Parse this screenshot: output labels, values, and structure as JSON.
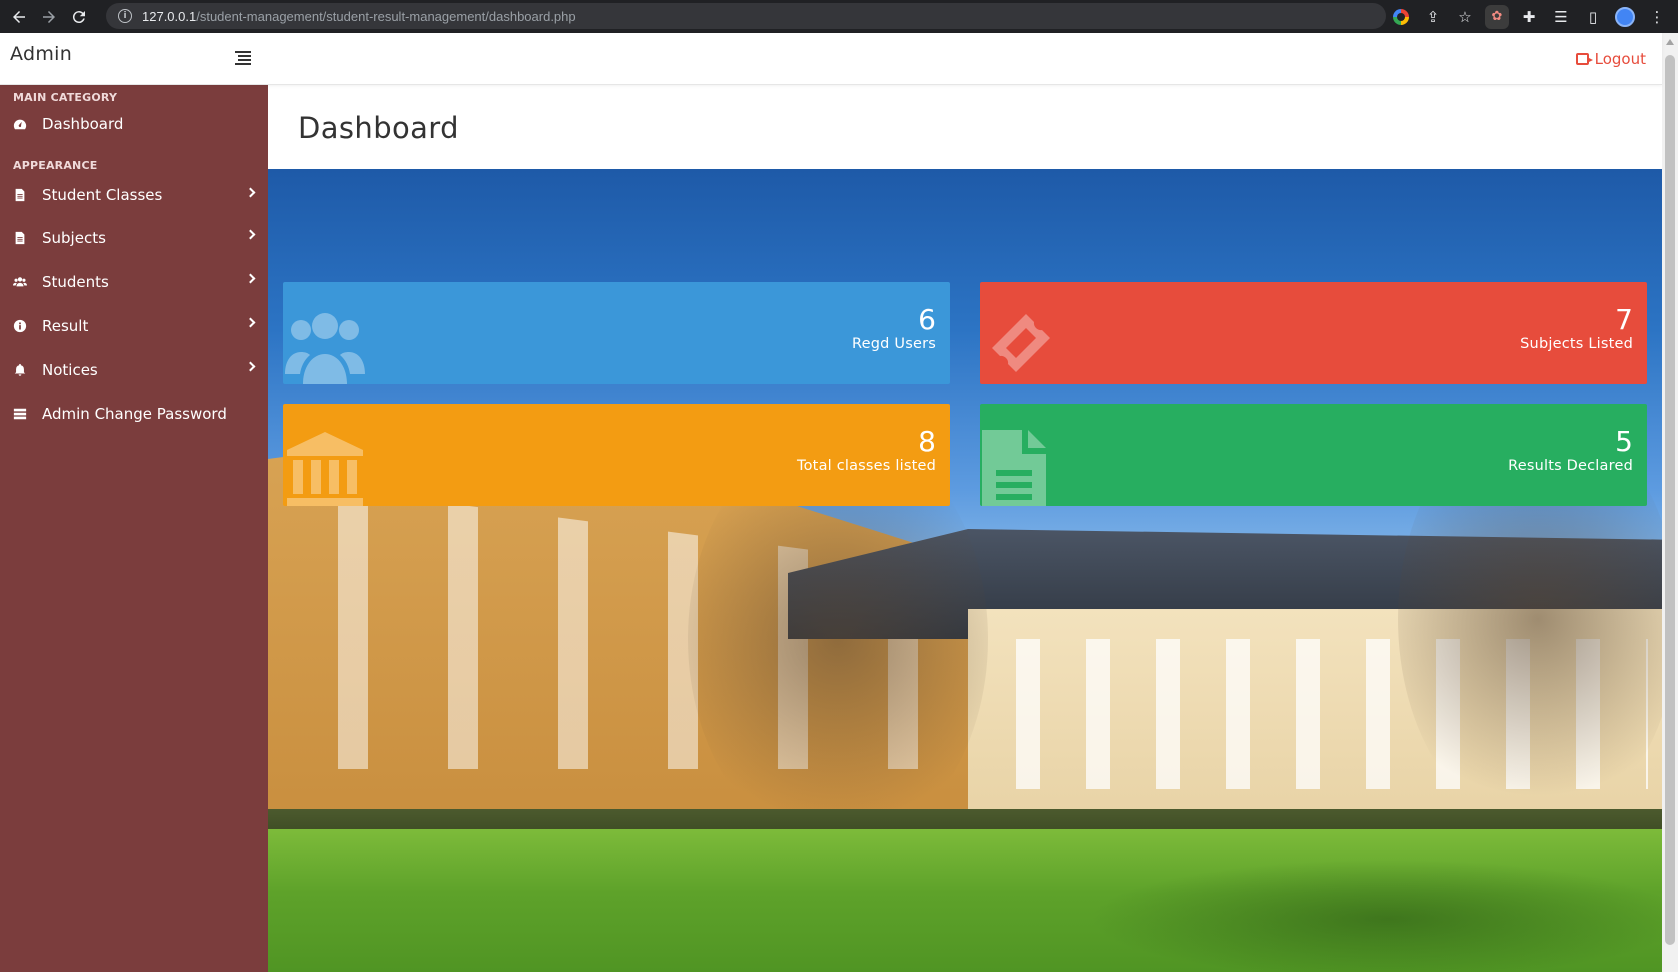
{
  "browser": {
    "url_host": "127.0.0.1",
    "url_path": "/student-management/student-result-management/dashboard.php"
  },
  "header": {
    "brand": "Admin",
    "logout_label": "Logout"
  },
  "sidebar": {
    "main_heading": "MAIN CATEGORY",
    "appearance_heading": "APPEARANCE",
    "items": [
      {
        "label": "Dashboard",
        "icon": "dashboard-icon"
      },
      {
        "label": "Student Classes",
        "icon": "file-icon"
      },
      {
        "label": "Subjects",
        "icon": "file-icon"
      },
      {
        "label": "Students",
        "icon": "users-icon"
      },
      {
        "label": "Result",
        "icon": "info-icon"
      },
      {
        "label": "Notices",
        "icon": "bell-icon"
      },
      {
        "label": "Admin Change Password",
        "icon": "server-icon"
      }
    ]
  },
  "main": {
    "title": "Dashboard"
  },
  "cards": [
    {
      "value": "6",
      "label": "Regd Users",
      "color": "#3b97d9",
      "icon": "users-icon"
    },
    {
      "value": "7",
      "label": "Subjects Listed",
      "color": "#e74c3c",
      "icon": "ticket-icon"
    },
    {
      "value": "8",
      "label": "Total classes listed",
      "color": "#f39c12",
      "icon": "bank-icon"
    },
    {
      "value": "5",
      "label": "Results Declared",
      "color": "#27ae60",
      "icon": "file-text-icon"
    }
  ],
  "colors": {
    "sidebar_bg": "#7b3d3d",
    "logout": "#e74c3c"
  }
}
